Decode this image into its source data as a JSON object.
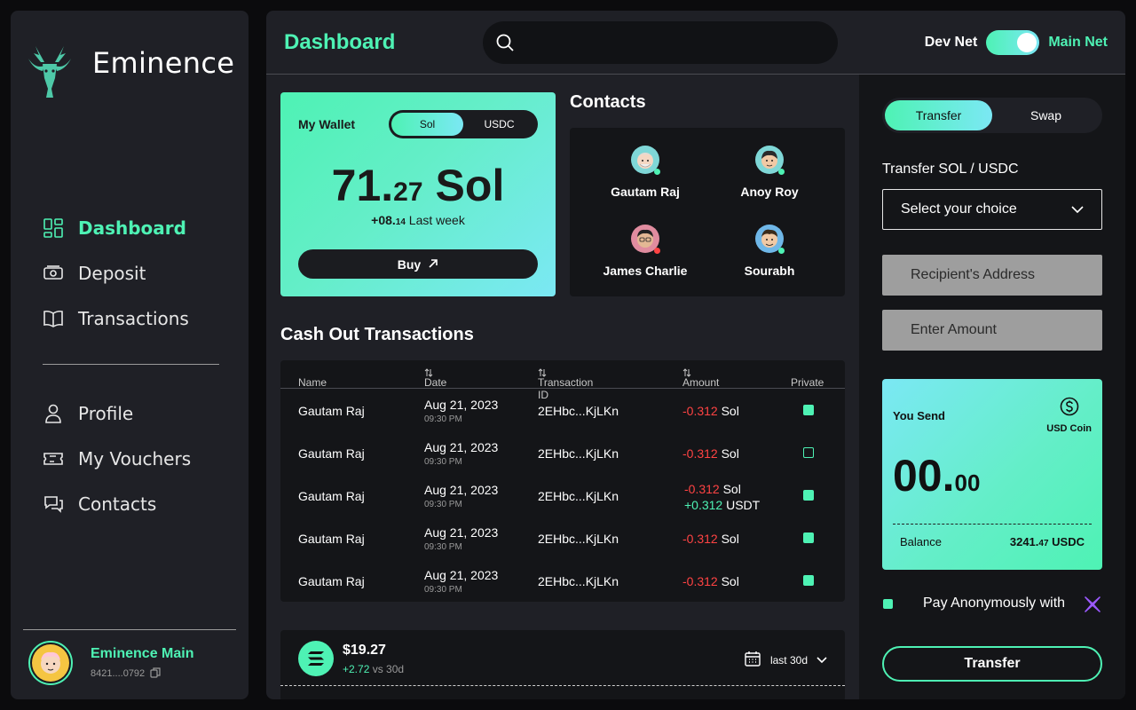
{
  "brand": "Eminence",
  "sidebar": {
    "items": [
      {
        "label": "Dashboard",
        "icon": "dashboard-icon",
        "active": true
      },
      {
        "label": "Deposit",
        "icon": "deposit-icon"
      },
      {
        "label": "Transactions",
        "icon": "book-icon"
      },
      {
        "label": "Profile",
        "icon": "user-icon"
      },
      {
        "label": "My Vouchers",
        "icon": "ticket-icon"
      },
      {
        "label": "Contacts",
        "icon": "chat-icon"
      }
    ],
    "account": {
      "name": "Eminence Main",
      "address": "8421....0792"
    }
  },
  "header": {
    "title": "Dashboard",
    "search_placeholder": "",
    "net_left": "Dev Net",
    "net_right": "Main Net"
  },
  "wallet": {
    "title": "My Wallet",
    "tokens": [
      "Sol",
      "USDC"
    ],
    "selected_token": "Sol",
    "balance_int": "71.",
    "balance_dec": "27",
    "balance_unit": "Sol",
    "change_int": "+08.",
    "change_dec": "14",
    "change_label": "Last week",
    "buy_label": "Buy"
  },
  "contacts": {
    "title": "Contacts",
    "list": [
      "Gautam Raj",
      "Anoy Roy",
      "James Charlie",
      "Sourabh"
    ]
  },
  "transactions": {
    "title": "Cash Out Transactions",
    "columns": [
      "Name",
      "Date",
      "Transaction ID",
      "Amount",
      "Private"
    ],
    "rows": [
      {
        "name": "Gautam Raj",
        "date": "Aug 21, 2023",
        "time": "09:30 PM",
        "id": "2EHbc...KjLKn",
        "amount": "-0.312",
        "unit": "Sol",
        "private": true
      },
      {
        "name": "Gautam Raj",
        "date": "Aug 21, 2023",
        "time": "09:30 PM",
        "id": "2EHbc...KjLKn",
        "amount": "-0.312",
        "unit": "Sol",
        "private": false
      },
      {
        "name": "Gautam Raj",
        "date": "Aug 21, 2023",
        "time": "09:30 PM",
        "id": "2EHbc...KjLKn",
        "amount": "-0.312",
        "unit": "Sol",
        "amount2": "+0.312",
        "unit2": "USDT",
        "private": true
      },
      {
        "name": "Gautam Raj",
        "date": "Aug 21, 2023",
        "time": "09:30 PM",
        "id": "2EHbc...KjLKn",
        "amount": "-0.312",
        "unit": "Sol",
        "private": true
      },
      {
        "name": "Gautam Raj",
        "date": "Aug 21, 2023",
        "time": "09:30 PM",
        "id": "2EHbc...KjLKn",
        "amount": "-0.312",
        "unit": "Sol",
        "private": true
      }
    ]
  },
  "price_card": {
    "amount": "$19.27",
    "change": "+2.72",
    "change_suffix": "vs 30d",
    "range": "last 30d"
  },
  "transfer_panel": {
    "tabs": [
      "Transfer",
      "Swap"
    ],
    "active_tab": "Transfer",
    "label": "Transfer SOL / USDC",
    "select_placeholder": "Select your choice",
    "recipient_placeholder": "Recipient's Address",
    "amount_placeholder": "Enter Amount",
    "you_send": "You Send",
    "coin": "USD Coin",
    "send_int": "00.",
    "send_dec": "00",
    "balance_label": "Balance",
    "balance_int": "3241.",
    "balance_dec": "47",
    "balance_unit": "USDC",
    "anon_label": "Pay Anonymously with",
    "button": "Transfer"
  },
  "colors": {
    "accent": "#4ef2b4",
    "accent2": "#7be8f4",
    "negative": "#ff4343",
    "panel": "#1f2026",
    "card": "#141518"
  }
}
